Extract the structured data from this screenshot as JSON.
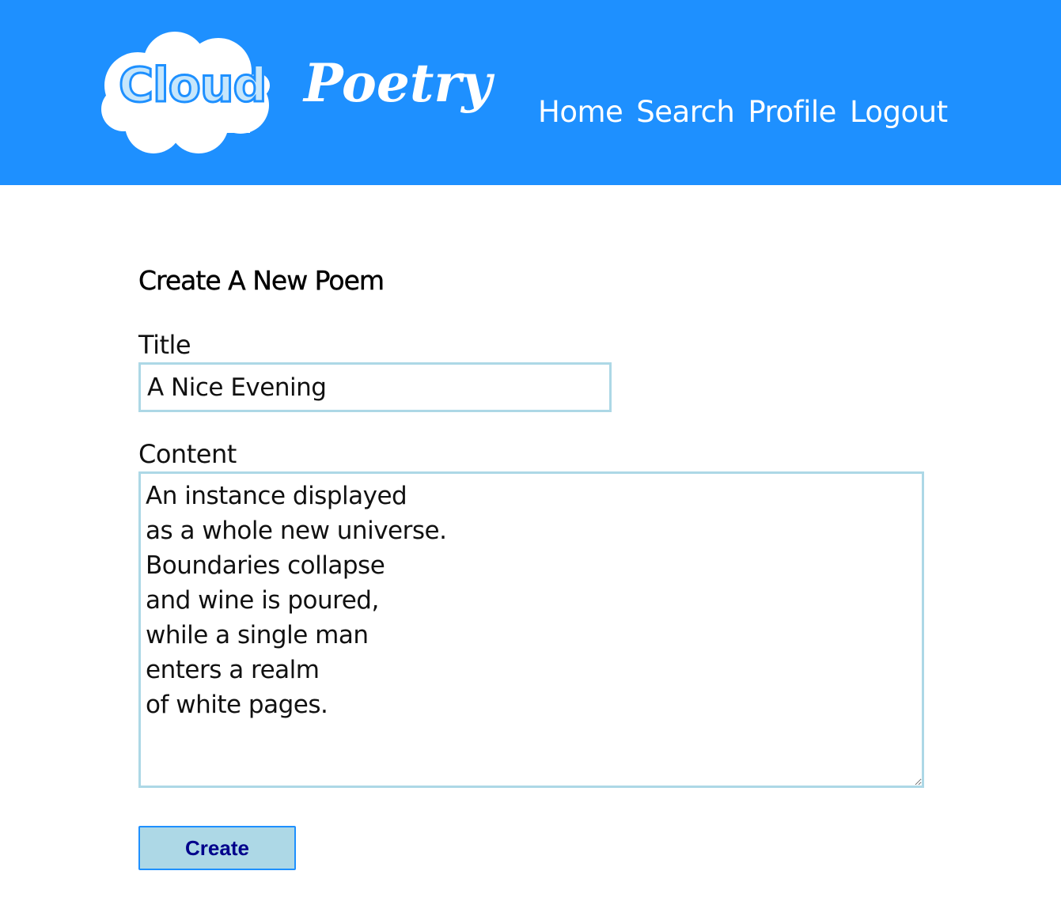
{
  "header": {
    "logo": {
      "cloud_word": "Cloud",
      "poetry_word": "Poetry"
    },
    "nav": [
      "Home",
      "Search",
      "Profile",
      "Logout"
    ]
  },
  "main": {
    "page_title": "Create A New Poem",
    "title_label": "Title",
    "title_value": "A Nice Evening",
    "content_label": "Content",
    "content_value": "An instance displayed\nas a whole new universe.\nBoundaries collapse\nand wine is poured,\nwhile a single man\nenters a realm\nof white pages.",
    "create_label": "Create"
  },
  "colors": {
    "header_bg": "#1e90ff",
    "input_border": "#add8e6",
    "button_bg": "#add8e6",
    "button_text": "#00008b"
  }
}
